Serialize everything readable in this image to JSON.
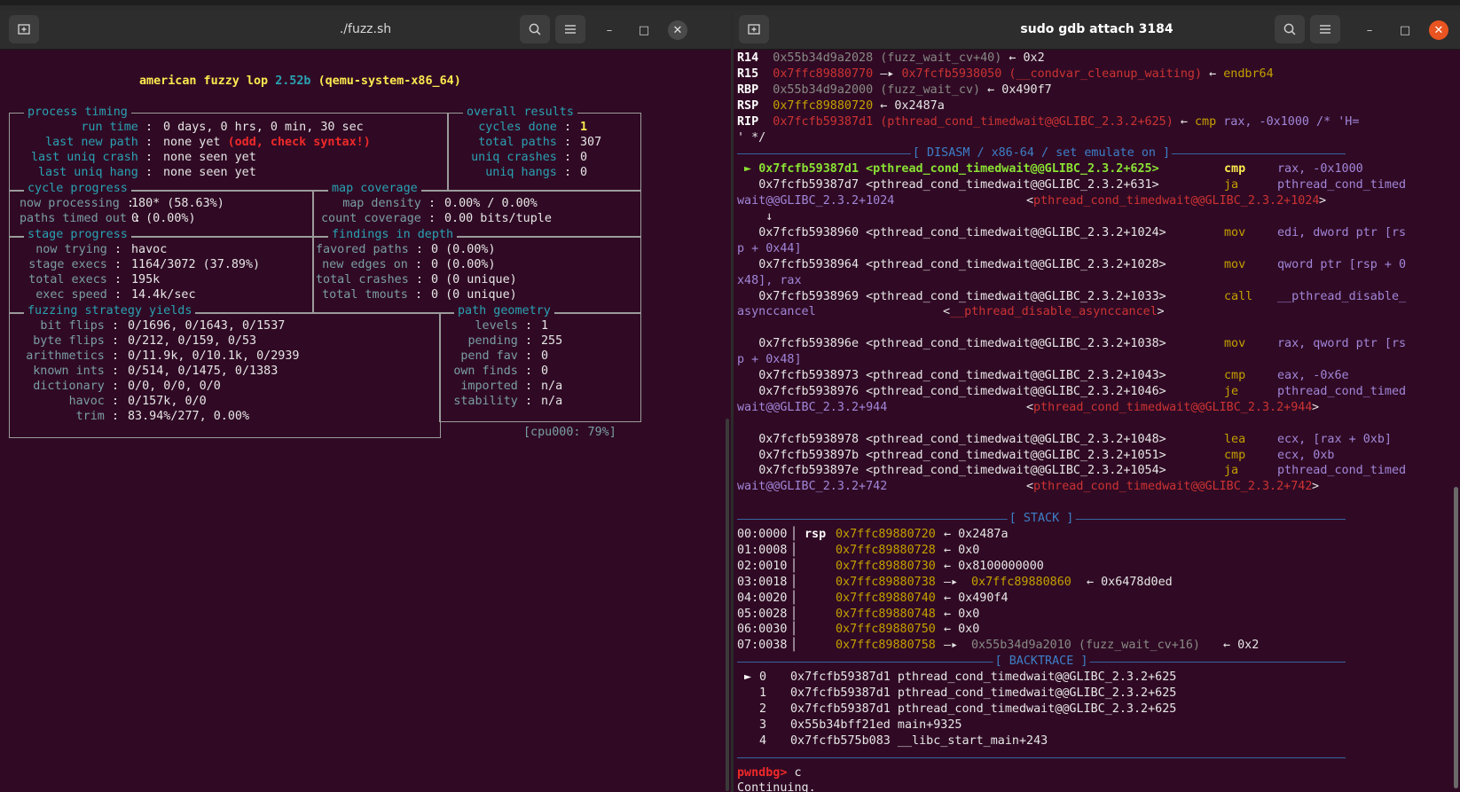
{
  "left_window": {
    "title": "./fuzz.sh",
    "header": {
      "app": "american fuzzy lop",
      "version": "2.52b",
      "target": "(qemu-system-x86_64)"
    },
    "process_timing": {
      "legend": "process timing",
      "run_time_label": "run time",
      "run_time": "0 days, 0 hrs, 0 min, 30 sec",
      "last_new_path_label": "last new path",
      "last_new_path": "none yet",
      "last_new_path_warn": "(odd, check syntax!)",
      "last_uniq_crash_label": "last uniq crash",
      "last_uniq_crash": "none seen yet",
      "last_uniq_hang_label": "last uniq hang",
      "last_uniq_hang": "none seen yet"
    },
    "overall_results": {
      "legend": "overall results",
      "cycles_done_label": "cycles done",
      "cycles_done": "1",
      "total_paths_label": "total paths",
      "total_paths": "307",
      "uniq_crashes_label": "uniq crashes",
      "uniq_crashes": "0",
      "uniq_hangs_label": "uniq hangs",
      "uniq_hangs": "0"
    },
    "cycle_progress": {
      "legend": "cycle progress",
      "now_processing_label": "now processing",
      "now_processing": "180* (58.63%)",
      "paths_timed_out_label": "paths timed out",
      "paths_timed_out": "0 (0.00%)"
    },
    "map_coverage": {
      "legend": "map coverage",
      "map_density_label": "map density",
      "map_density": "0.00% / 0.00%",
      "count_coverage_label": "count coverage",
      "count_coverage": "0.00 bits/tuple"
    },
    "stage_progress": {
      "legend": "stage progress",
      "now_trying_label": "now trying",
      "now_trying": "havoc",
      "stage_execs_label": "stage execs",
      "stage_execs": "1164/3072 (37.89%)",
      "total_execs_label": "total execs",
      "total_execs": "195k",
      "exec_speed_label": "exec speed",
      "exec_speed": "14.4k/sec"
    },
    "findings_in_depth": {
      "legend": "findings in depth",
      "favored_paths_label": "favored paths",
      "favored_paths": "0 (0.00%)",
      "new_edges_on_label": "new edges on",
      "new_edges_on": "0 (0.00%)",
      "total_crashes_label": "total crashes",
      "total_crashes": "0 (0 unique)",
      "total_tmouts_label": "total tmouts",
      "total_tmouts": "0 (0 unique)"
    },
    "fuzzing_strategy_yields": {
      "legend": "fuzzing strategy yields",
      "bit_flips_label": "bit flips",
      "bit_flips": "0/1696, 0/1643, 0/1537",
      "byte_flips_label": "byte flips",
      "byte_flips": "0/212, 0/159, 0/53",
      "arithmetics_label": "arithmetics",
      "arithmetics": "0/11.9k, 0/10.1k, 0/2939",
      "known_ints_label": "known ints",
      "known_ints": "0/514, 0/1475, 0/1383",
      "dictionary_label": "dictionary",
      "dictionary": "0/0, 0/0, 0/0",
      "havoc_label": "havoc",
      "havoc": "0/157k, 0/0",
      "trim_label": "trim",
      "trim": "83.94%/277, 0.00%"
    },
    "path_geometry": {
      "legend": "path geometry",
      "levels_label": "levels",
      "levels": "1",
      "pending_label": "pending",
      "pending": "255",
      "pend_fav_label": "pend fav",
      "pend_fav": "0",
      "own_finds_label": "own finds",
      "own_finds": "0",
      "imported_label": "imported",
      "imported": "n/a",
      "stability_label": "stability",
      "stability": "n/a"
    },
    "cpu": "[cpu000: 79%]"
  },
  "right_window": {
    "title": "sudo gdb attach 3184",
    "registers": [
      {
        "name": "R14",
        "addr": "0x55b34d9a2028",
        "sym": "(fuzz_wait_cv+40)",
        "val": "0x2"
      },
      {
        "name": "R15",
        "addr": "0x7ffc89880770",
        "ptr": "0x7fcfb5938050",
        "sym": "(__condvar_cleanup_waiting)",
        "val": "endbr64"
      },
      {
        "name": "RBP",
        "addr": "0x55b34d9a2000",
        "sym": "(fuzz_wait_cv)",
        "val": "0x490f7"
      },
      {
        "name": "RSP",
        "addr": "0x7ffc89880720",
        "val": "0x2487a"
      },
      {
        "name": "RIP",
        "addr": "0x7fcfb59387d1",
        "sym": "(pthread_cond_timedwait@@GLIBC_2.3.2+625)",
        "val_op": "cmp",
        "val_args": "rax, -0x1000",
        "val_comment": "/* 'H=",
        "cont": "' */"
      }
    ],
    "disasm_header": "[ DISASM / x86-64 / set emulate on ]",
    "disasm": [
      {
        "addr": "0x7fcfb59387d1",
        "sym": "<pthread_cond_timedwait@@GLIBC_2.3.2+625>",
        "op": "cmp",
        "args": "rax, -0x1000"
      },
      {
        "addr": "0x7fcfb59387d7",
        "sym": "<pthread_cond_timedwait@@GLIBC_2.3.2+631>",
        "op": "ja",
        "args": "pthread_cond_timed",
        "wrap": "wait@@GLIBC_2.3.2+1024",
        "target": "<pthread_cond_timedwait@@GLIBC_2.3.2+1024>"
      },
      {
        "addr": "0x7fcfb5938960",
        "sym": "<pthread_cond_timedwait@@GLIBC_2.3.2+1024>",
        "op": "mov",
        "args": "edi, dword ptr [rs",
        "wrap": "p + 0x44]"
      },
      {
        "addr": "0x7fcfb5938964",
        "sym": "<pthread_cond_timedwait@@GLIBC_2.3.2+1028>",
        "op": "mov",
        "args": "qword ptr [rsp + 0",
        "wrap": "x48], rax"
      },
      {
        "addr": "0x7fcfb5938969",
        "sym": "<pthread_cond_timedwait@@GLIBC_2.3.2+1033>",
        "op": "call",
        "args": "__pthread_disable_",
        "wrap": "asynccancel",
        "target": "<__pthread_disable_asynccancel>"
      },
      {
        "addr": "0x7fcfb593896e",
        "sym": "<pthread_cond_timedwait@@GLIBC_2.3.2+1038>",
        "op": "mov",
        "args": "rax, qword ptr [rs",
        "wrap": "p + 0x48]"
      },
      {
        "addr": "0x7fcfb5938973",
        "sym": "<pthread_cond_timedwait@@GLIBC_2.3.2+1043>",
        "op": "cmp",
        "args": "eax, -0x6e"
      },
      {
        "addr": "0x7fcfb5938976",
        "sym": "<pthread_cond_timedwait@@GLIBC_2.3.2+1046>",
        "op": "je",
        "args": "pthread_cond_timed",
        "wrap": "wait@@GLIBC_2.3.2+944",
        "target": "<pthread_cond_timedwait@@GLIBC_2.3.2+944>"
      },
      {
        "addr": "0x7fcfb5938978",
        "sym": "<pthread_cond_timedwait@@GLIBC_2.3.2+1048>",
        "op": "lea",
        "args": "ecx, [rax + 0xb]"
      },
      {
        "addr": "0x7fcfb593897b",
        "sym": "<pthread_cond_timedwait@@GLIBC_2.3.2+1051>",
        "op": "cmp",
        "args": "ecx, 0xb"
      },
      {
        "addr": "0x7fcfb593897e",
        "sym": "<pthread_cond_timedwait@@GLIBC_2.3.2+1054>",
        "op": "ja",
        "args": "pthread_cond_timed",
        "wrap": "wait@@GLIBC_2.3.2+742",
        "target": "<pthread_cond_timedwait@@GLIBC_2.3.2+742>"
      }
    ],
    "stack_header": "[ STACK ]",
    "stack": [
      {
        "off": "00:0000",
        "reg": "rsp",
        "addr": "0x7ffc89880720",
        "val": "0x2487a"
      },
      {
        "off": "01:0008",
        "reg": "",
        "addr": "0x7ffc89880728",
        "val": "0x0"
      },
      {
        "off": "02:0010",
        "reg": "",
        "addr": "0x7ffc89880730",
        "val": "0x8100000000"
      },
      {
        "off": "03:0018",
        "reg": "",
        "addr": "0x7ffc89880738",
        "ptr": "0x7ffc89880860",
        "val": "0x6478d0ed"
      },
      {
        "off": "04:0020",
        "reg": "",
        "addr": "0x7ffc89880740",
        "val": "0x490f4"
      },
      {
        "off": "05:0028",
        "reg": "",
        "addr": "0x7ffc89880748",
        "val": "0x0"
      },
      {
        "off": "06:0030",
        "reg": "",
        "addr": "0x7ffc89880750",
        "val": "0x0"
      },
      {
        "off": "07:0038",
        "reg": "",
        "addr": "0x7ffc89880758",
        "ptr": "0x55b34d9a2010",
        "ptr_sym": "(fuzz_wait_cv+16)",
        "val": "0x2"
      }
    ],
    "backtrace_header": "[ BACKTRACE ]",
    "backtrace": [
      {
        "n": "0",
        "addr": "0x7fcfb59387d1",
        "sym": "pthread_cond_timedwait@@GLIBC_2.3.2+625"
      },
      {
        "n": "1",
        "addr": "0x7fcfb59387d1",
        "sym": "pthread_cond_timedwait@@GLIBC_2.3.2+625"
      },
      {
        "n": "2",
        "addr": "0x7fcfb59387d1",
        "sym": "pthread_cond_timedwait@@GLIBC_2.3.2+625"
      },
      {
        "n": "3",
        "addr": "0x55b34bff21ed",
        "sym": "main+9325"
      },
      {
        "n": "4",
        "addr": "0x7fcfb575b083",
        "sym": "__libc_start_main+243"
      }
    ],
    "prompt": "pwndbg>",
    "command": "c",
    "output": "Continuing."
  },
  "icons": {
    "new_tab": "new-tab-icon",
    "search": "search-icon",
    "menu": "hamburger-menu-icon",
    "minimize": "minimize-icon",
    "maximize": "maximize-icon",
    "close": "close-icon"
  },
  "colors": {
    "terminal_bg": "#300a24",
    "cyan": "#2aa1b3",
    "yellow": "#fce94f",
    "red": "#ef2929",
    "green": "#8ae234",
    "ubuntu_orange": "#e95420"
  }
}
